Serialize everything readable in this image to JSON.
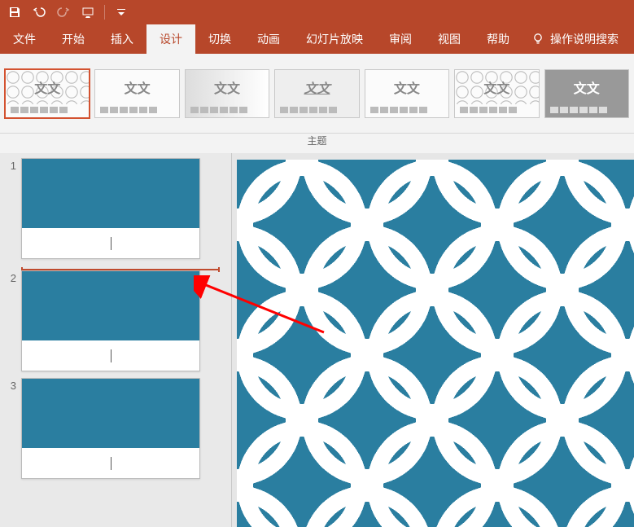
{
  "titlebar": {
    "icons": [
      "save",
      "undo",
      "redo",
      "start-from-beginning",
      "customize-qat"
    ]
  },
  "tabs": {
    "items": [
      {
        "label": "文件"
      },
      {
        "label": "开始"
      },
      {
        "label": "插入"
      },
      {
        "label": "设计",
        "active": true
      },
      {
        "label": "切换"
      },
      {
        "label": "动画"
      },
      {
        "label": "幻灯片放映"
      },
      {
        "label": "审阅"
      },
      {
        "label": "视图"
      },
      {
        "label": "帮助"
      }
    ],
    "tell_me": "操作说明搜索"
  },
  "themes": {
    "group_label": "主题",
    "thumb_text": "文文",
    "items": [
      {
        "variant": "t0",
        "selected": true
      },
      {
        "variant": "t1"
      },
      {
        "variant": "t2"
      },
      {
        "variant": "t3"
      },
      {
        "variant": "t4"
      },
      {
        "variant": "t5"
      },
      {
        "variant": "t6 dark"
      }
    ]
  },
  "slides": {
    "items": [
      {
        "num": "1"
      },
      {
        "num": "2"
      },
      {
        "num": "3"
      }
    ],
    "insertion_after_index": 0
  },
  "annotation": {
    "arrow_color": "#ff0000"
  }
}
